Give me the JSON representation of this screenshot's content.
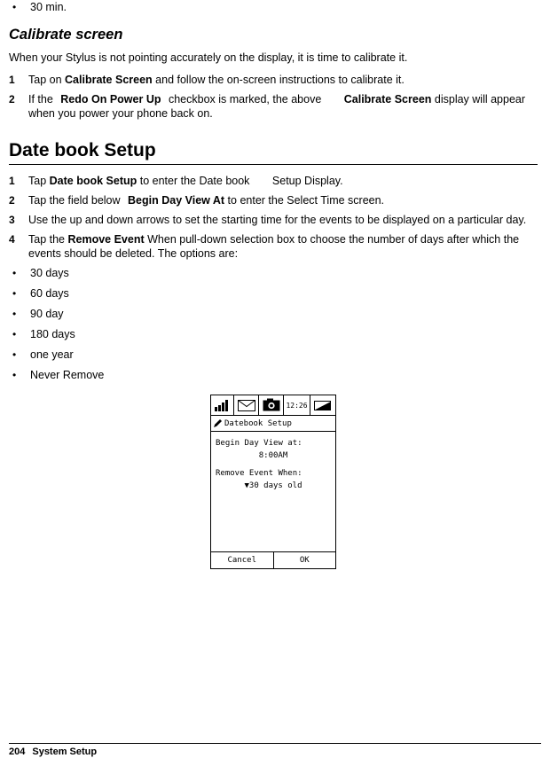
{
  "top_bullet": {
    "mark": "•",
    "text": "30 min."
  },
  "calibrate": {
    "heading": "Calibrate screen",
    "intro": "When your Stylus is not pointing accurately on the display, it is time to calibrate it.",
    "steps": [
      {
        "num": "1",
        "pre": "Tap on ",
        "bold1": "Calibrate Screen",
        "mid": " and follow the on-screen instructions to calibrate it.",
        "bold2": "",
        "post": ""
      },
      {
        "num": "2",
        "pre": "If the ",
        "bold1": "Redo On Power Up",
        "mid": " checkbox is marked, the above ",
        "bold2": "Calibrate Screen",
        "post": " display will appear when you power your phone back on."
      }
    ]
  },
  "datebook": {
    "heading": "Date book Setup",
    "steps": [
      {
        "num": "1",
        "pre": "Tap ",
        "bold1": "Date book  Setup",
        "mid": " to enter the Date book ",
        "bold2": "",
        "post": "Setup Display."
      },
      {
        "num": "2",
        "pre": "Tap the field below ",
        "bold1": "Begin Day View At",
        "mid": " to enter the Select Time screen.",
        "bold2": "",
        "post": ""
      },
      {
        "num": "3",
        "pre": "Use the up and down arrows to set the starting time for the events to be displayed on a particular day.",
        "bold1": "",
        "mid": "",
        "bold2": "",
        "post": ""
      },
      {
        "num": "4",
        "pre": "Tap the ",
        "bold1": "Remove Event",
        "mid": " When pull-down selection box to choose the number of days after which the events should be deleted. The options are:",
        "bold2": "",
        "post": ""
      }
    ],
    "options": [
      "30 days",
      "60 days",
      "90 day",
      "180 days",
      "one year",
      "Never Remove"
    ],
    "bullet_mark": "•"
  },
  "device": {
    "status": {
      "signal_icon": "signal-bars-icon",
      "mail_icon": "envelope-icon",
      "camera_icon": "camera-icon",
      "time": "12:26",
      "battery_icon": "battery-icon"
    },
    "title": "Datebook Setup",
    "title_icon": "pen-icon",
    "lines": [
      "Begin Day View at:",
      "8:00AM",
      "Remove Event When:",
      "30 days old"
    ],
    "dropdown_arrow": "▼",
    "buttons": {
      "cancel": "Cancel",
      "ok": "OK"
    }
  },
  "footer": {
    "page_number": "204",
    "label": "System Setup"
  }
}
